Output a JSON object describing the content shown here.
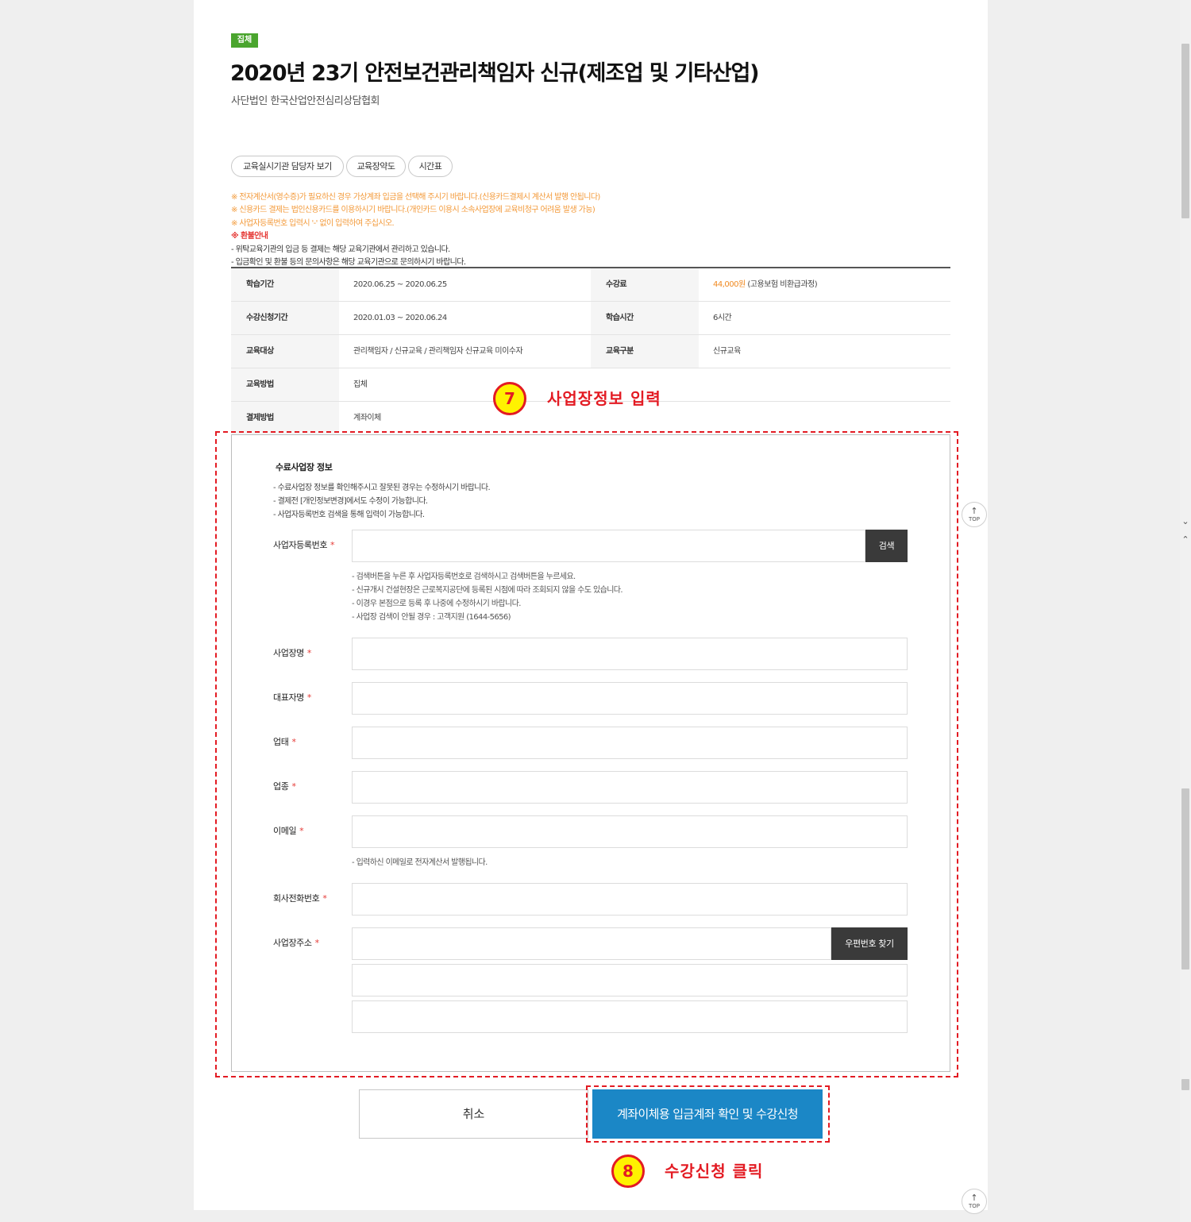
{
  "header": {
    "badge": "집체",
    "title": "2020년 23기 안전보건관리책임자 신규(제조업 및 기타산업)",
    "org": "사단법인 한국산업안전심리상담협회"
  },
  "pills": [
    "교육실시기관 담당자 보기",
    "교육장약도",
    "시간표"
  ],
  "notices": {
    "orange": [
      "※ 전자계산서(영수증)가 필요하신 경우 가상계좌 입금을 선택해 주시기 바랍니다.(신용카드결제시 계산서 발행 안됩니다)",
      "※ 신용카드 결제는 법인신용카드를 이용하시기 바랍니다.(개인카드 이용시 소속사업장에 교육비청구 어려움 발생 가능)",
      "※ 사업자등록번호 입력시 '-' 없이 입력하여 주십시오."
    ],
    "refund_title": "※ 환불안내",
    "dark": [
      "- 위탁교육기관의 입금 등 결제는 해당 교육기관에서 관리하고 있습니다.",
      "- 입금확인 및 환불 등의 문의사항은 해당 교육기관으로 문의하시기 바랍니다."
    ]
  },
  "info": {
    "study_period_label": "학습기간",
    "study_period": "2020.06.25 ~ 2020.06.25",
    "fee_label": "수강료",
    "fee_amount": "44,000원",
    "fee_note": "(고용보험 비환급과정)",
    "apply_period_label": "수강신청기간",
    "apply_period": "2020.01.03 ~ 2020.06.24",
    "hours_label": "학습시간",
    "hours": "6시간",
    "target_label": "교육대상",
    "target": "관리책임자 / 신규교육 / 관리책임자 신규교육 미이수자",
    "type_label": "교육구분",
    "type": "신규교육",
    "method_label": "교육방법",
    "method": "집체",
    "pay_label": "결제방법",
    "pay": "계좌이체"
  },
  "annotations": {
    "step7_num": "7",
    "step7_text": "사업장정보 입력",
    "step8_num": "8",
    "step8_text": "수강신청 클릭"
  },
  "form": {
    "section_title": "수료사업장 정보",
    "notes": [
      "- 수료사업장 정보를 확인해주시고 잘못된 경우는 수정하시기 바랍니다.",
      "- 결제전 [개인정보변경]에서도 수정이 가능합니다.",
      "- 사업자등록번호 검색을 통해 입력이 가능합니다."
    ],
    "required_mark": "*",
    "bizno_label": "사업자등록번호",
    "search_button": "검색",
    "bizno_hints": [
      "- 검색버튼을 누른 후 사업자등록번호로 검색하시고 검색버튼을 누르세요.",
      "- 신규개시 건설현장은 근로복지공단에 등록된 시점에 따라 조회되지 않을 수도 있습니다.",
      "- 이경우 본점으로 등록 후 나중에 수정하시기 바랍니다.",
      "- 사업장 검색이 안될 경우 : 고객지원 (1644-5656)"
    ],
    "company_label": "사업장명",
    "ceo_label": "대표자명",
    "business_label": "업태",
    "industry_label": "업종",
    "email_label": "이메일",
    "email_hint": "- 입력하신 이메일로 전자계산서 발행됩니다.",
    "phone_label": "회사전화번호",
    "address_label": "사업장주소",
    "zipcode_button": "우편번호 찾기"
  },
  "buttons": {
    "cancel": "취소",
    "submit": "계좌이체용 입금계좌 확인 및 수강신청"
  },
  "top_button": {
    "arrow": "↑",
    "label": "TOP"
  },
  "scroll_arrows": {
    "down": "⌄",
    "up": "⌃"
  }
}
